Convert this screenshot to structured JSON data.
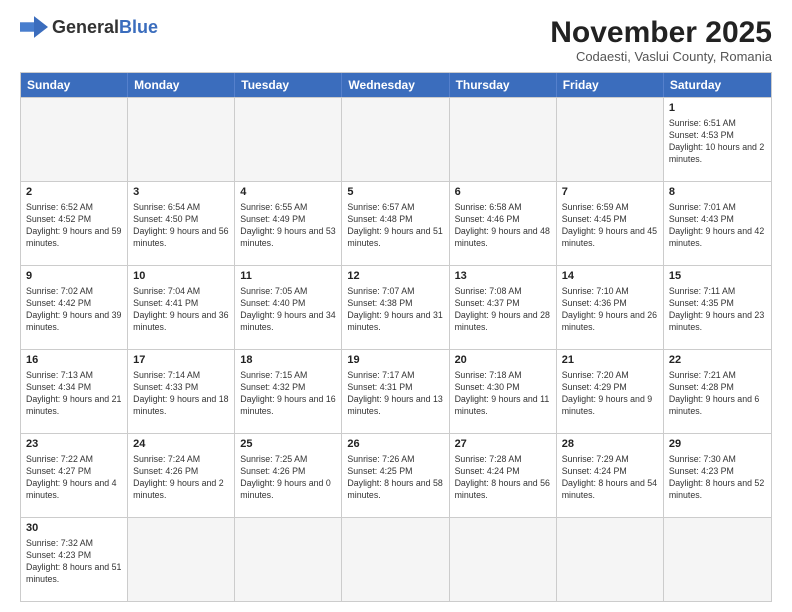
{
  "header": {
    "logo_general": "General",
    "logo_blue": "Blue",
    "month_title": "November 2025",
    "subtitle": "Codaesti, Vaslui County, Romania"
  },
  "days_of_week": [
    "Sunday",
    "Monday",
    "Tuesday",
    "Wednesday",
    "Thursday",
    "Friday",
    "Saturday"
  ],
  "weeks": [
    [
      {
        "day": "",
        "empty": true
      },
      {
        "day": "",
        "empty": true
      },
      {
        "day": "",
        "empty": true
      },
      {
        "day": "",
        "empty": true
      },
      {
        "day": "",
        "empty": true
      },
      {
        "day": "",
        "empty": true
      },
      {
        "day": "1",
        "sunrise": "6:51 AM",
        "sunset": "4:53 PM",
        "daylight": "10 hours and 2 minutes."
      }
    ],
    [
      {
        "day": "2",
        "sunrise": "6:52 AM",
        "sunset": "4:52 PM",
        "daylight": "9 hours and 59 minutes."
      },
      {
        "day": "3",
        "sunrise": "6:54 AM",
        "sunset": "4:50 PM",
        "daylight": "9 hours and 56 minutes."
      },
      {
        "day": "4",
        "sunrise": "6:55 AM",
        "sunset": "4:49 PM",
        "daylight": "9 hours and 53 minutes."
      },
      {
        "day": "5",
        "sunrise": "6:57 AM",
        "sunset": "4:48 PM",
        "daylight": "9 hours and 51 minutes."
      },
      {
        "day": "6",
        "sunrise": "6:58 AM",
        "sunset": "4:46 PM",
        "daylight": "9 hours and 48 minutes."
      },
      {
        "day": "7",
        "sunrise": "6:59 AM",
        "sunset": "4:45 PM",
        "daylight": "9 hours and 45 minutes."
      },
      {
        "day": "8",
        "sunrise": "7:01 AM",
        "sunset": "4:43 PM",
        "daylight": "9 hours and 42 minutes."
      }
    ],
    [
      {
        "day": "9",
        "sunrise": "7:02 AM",
        "sunset": "4:42 PM",
        "daylight": "9 hours and 39 minutes."
      },
      {
        "day": "10",
        "sunrise": "7:04 AM",
        "sunset": "4:41 PM",
        "daylight": "9 hours and 36 minutes."
      },
      {
        "day": "11",
        "sunrise": "7:05 AM",
        "sunset": "4:40 PM",
        "daylight": "9 hours and 34 minutes."
      },
      {
        "day": "12",
        "sunrise": "7:07 AM",
        "sunset": "4:38 PM",
        "daylight": "9 hours and 31 minutes."
      },
      {
        "day": "13",
        "sunrise": "7:08 AM",
        "sunset": "4:37 PM",
        "daylight": "9 hours and 28 minutes."
      },
      {
        "day": "14",
        "sunrise": "7:10 AM",
        "sunset": "4:36 PM",
        "daylight": "9 hours and 26 minutes."
      },
      {
        "day": "15",
        "sunrise": "7:11 AM",
        "sunset": "4:35 PM",
        "daylight": "9 hours and 23 minutes."
      }
    ],
    [
      {
        "day": "16",
        "sunrise": "7:13 AM",
        "sunset": "4:34 PM",
        "daylight": "9 hours and 21 minutes."
      },
      {
        "day": "17",
        "sunrise": "7:14 AM",
        "sunset": "4:33 PM",
        "daylight": "9 hours and 18 minutes."
      },
      {
        "day": "18",
        "sunrise": "7:15 AM",
        "sunset": "4:32 PM",
        "daylight": "9 hours and 16 minutes."
      },
      {
        "day": "19",
        "sunrise": "7:17 AM",
        "sunset": "4:31 PM",
        "daylight": "9 hours and 13 minutes."
      },
      {
        "day": "20",
        "sunrise": "7:18 AM",
        "sunset": "4:30 PM",
        "daylight": "9 hours and 11 minutes."
      },
      {
        "day": "21",
        "sunrise": "7:20 AM",
        "sunset": "4:29 PM",
        "daylight": "9 hours and 9 minutes."
      },
      {
        "day": "22",
        "sunrise": "7:21 AM",
        "sunset": "4:28 PM",
        "daylight": "9 hours and 6 minutes."
      }
    ],
    [
      {
        "day": "23",
        "sunrise": "7:22 AM",
        "sunset": "4:27 PM",
        "daylight": "9 hours and 4 minutes."
      },
      {
        "day": "24",
        "sunrise": "7:24 AM",
        "sunset": "4:26 PM",
        "daylight": "9 hours and 2 minutes."
      },
      {
        "day": "25",
        "sunrise": "7:25 AM",
        "sunset": "4:26 PM",
        "daylight": "9 hours and 0 minutes."
      },
      {
        "day": "26",
        "sunrise": "7:26 AM",
        "sunset": "4:25 PM",
        "daylight": "8 hours and 58 minutes."
      },
      {
        "day": "27",
        "sunrise": "7:28 AM",
        "sunset": "4:24 PM",
        "daylight": "8 hours and 56 minutes."
      },
      {
        "day": "28",
        "sunrise": "7:29 AM",
        "sunset": "4:24 PM",
        "daylight": "8 hours and 54 minutes."
      },
      {
        "day": "29",
        "sunrise": "7:30 AM",
        "sunset": "4:23 PM",
        "daylight": "8 hours and 52 minutes."
      }
    ],
    [
      {
        "day": "30",
        "sunrise": "7:32 AM",
        "sunset": "4:23 PM",
        "daylight": "8 hours and 51 minutes.",
        "last": true
      },
      {
        "day": "",
        "empty": true,
        "last": true
      },
      {
        "day": "",
        "empty": true,
        "last": true
      },
      {
        "day": "",
        "empty": true,
        "last": true
      },
      {
        "day": "",
        "empty": true,
        "last": true
      },
      {
        "day": "",
        "empty": true,
        "last": true
      },
      {
        "day": "",
        "empty": true,
        "last": true
      }
    ]
  ]
}
